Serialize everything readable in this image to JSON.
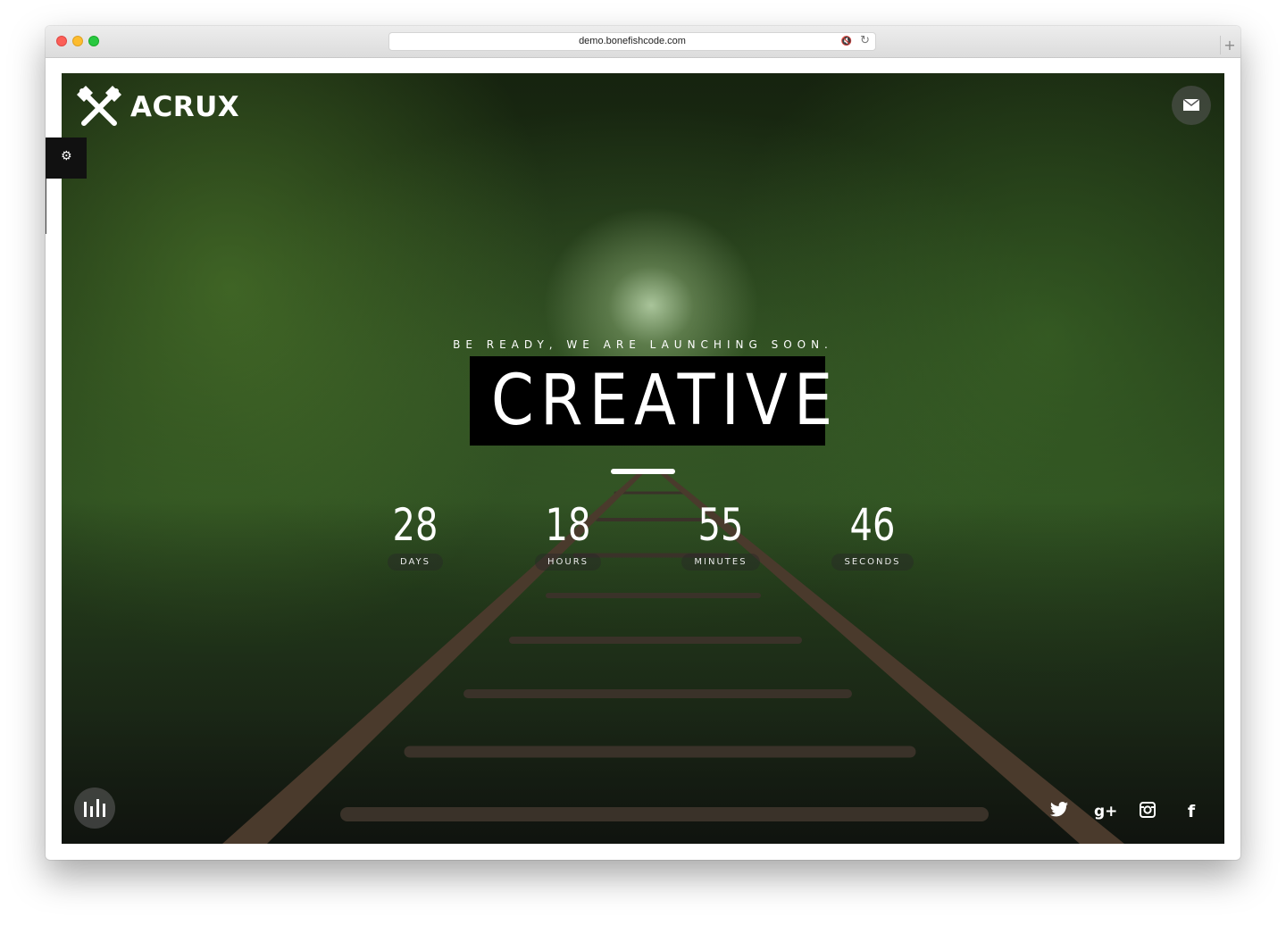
{
  "browser": {
    "url": "demo.bonefishcode.com",
    "new_tab_label": "+"
  },
  "site": {
    "logo_text": "ACRUX",
    "tagline": "BE READY, WE ARE LAUNCHING SOON.",
    "headline": "CREATIVE",
    "countdown": [
      {
        "value": "28",
        "label": "DAYS"
      },
      {
        "value": "18",
        "label": "HOURS"
      },
      {
        "value": "55",
        "label": "MINUTES"
      },
      {
        "value": "46",
        "label": "SECONDS"
      }
    ],
    "social": [
      {
        "name": "twitter-icon"
      },
      {
        "name": "google-plus-icon",
        "glyph": "g+"
      },
      {
        "name": "instagram-icon"
      },
      {
        "name": "facebook-icon",
        "glyph": "f"
      }
    ]
  },
  "icons": {
    "logo": "crossed-axes-icon",
    "mail": "envelope-icon",
    "settings": "gear-icon",
    "music": "sound-bars-icon",
    "mute": "speaker-muted-icon",
    "reload": "reload-icon"
  },
  "colors": {
    "foliage": "#2b4a1f",
    "headline_bg": "#000000",
    "text": "#ffffff"
  }
}
